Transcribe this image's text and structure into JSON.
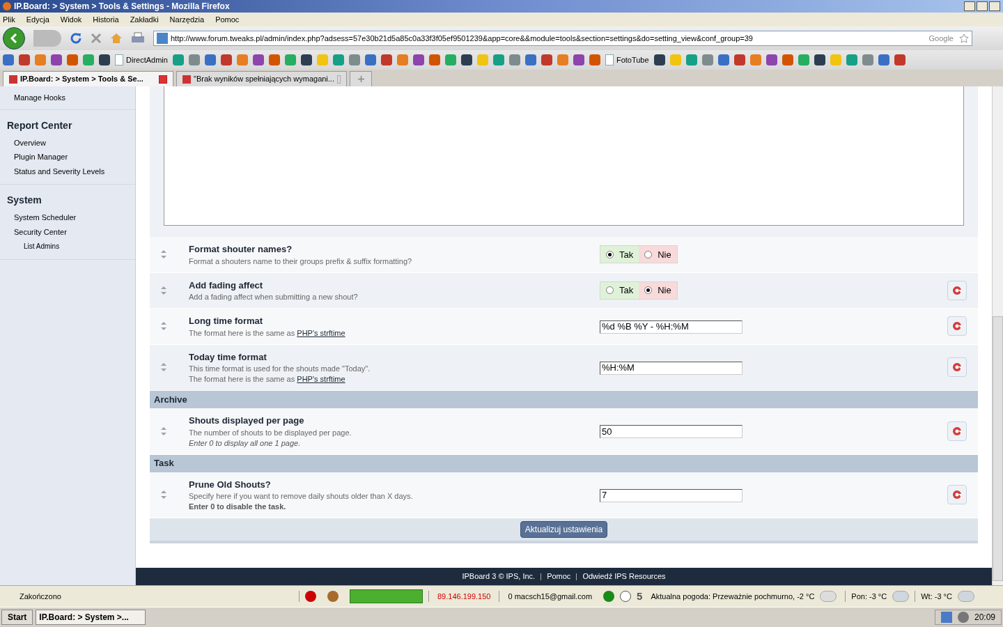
{
  "window": {
    "title": "IP.Board: > System > Tools & Settings - Mozilla Firefox"
  },
  "menu": [
    "Plik",
    "Edycja",
    "Widok",
    "Historia",
    "Zakładki",
    "Narzędzia",
    "Pomoc"
  ],
  "address_bar": {
    "value": "http://www.forum.tweaks.pl/admin/index.php?adsess=57e30b21d5a85c0a33f3f05ef9501239&app=core&&module=tools&section=settings&do=setting_view&conf_group=39"
  },
  "search": {
    "placeholder": "Google"
  },
  "bookmarks": [
    {
      "kind": "icon"
    },
    {
      "kind": "icon"
    },
    {
      "kind": "icon"
    },
    {
      "kind": "icon"
    },
    {
      "kind": "icon"
    },
    {
      "kind": "icon"
    },
    {
      "kind": "icon"
    },
    {
      "kind": "labeled",
      "label": "DirectAdmin"
    },
    {
      "kind": "icon"
    },
    {
      "kind": "icon"
    },
    {
      "kind": "icon"
    },
    {
      "kind": "icon"
    },
    {
      "kind": "icon"
    },
    {
      "kind": "icon"
    },
    {
      "kind": "icon"
    },
    {
      "kind": "icon"
    },
    {
      "kind": "icon"
    },
    {
      "kind": "icon"
    },
    {
      "kind": "icon"
    },
    {
      "kind": "icon"
    },
    {
      "kind": "icon"
    },
    {
      "kind": "icon"
    },
    {
      "kind": "icon"
    },
    {
      "kind": "icon"
    },
    {
      "kind": "icon"
    },
    {
      "kind": "icon"
    },
    {
      "kind": "icon"
    },
    {
      "kind": "icon"
    },
    {
      "kind": "icon"
    },
    {
      "kind": "icon"
    },
    {
      "kind": "icon"
    },
    {
      "kind": "icon"
    },
    {
      "kind": "icon"
    },
    {
      "kind": "icon"
    },
    {
      "kind": "icon"
    },
    {
      "kind": "labeled",
      "label": "FotoTube"
    },
    {
      "kind": "icon"
    },
    {
      "kind": "icon"
    },
    {
      "kind": "icon"
    },
    {
      "kind": "icon"
    },
    {
      "kind": "icon"
    },
    {
      "kind": "icon"
    },
    {
      "kind": "icon"
    },
    {
      "kind": "icon"
    },
    {
      "kind": "icon"
    },
    {
      "kind": "icon"
    },
    {
      "kind": "icon"
    },
    {
      "kind": "icon"
    },
    {
      "kind": "icon"
    },
    {
      "kind": "icon"
    },
    {
      "kind": "icon"
    },
    {
      "kind": "icon"
    }
  ],
  "tabs": [
    {
      "label": "IP.Board: > System > Tools & Se...",
      "selected": true
    },
    {
      "label": "\"Brak wyników spełniających wymagani...",
      "selected": false
    }
  ],
  "sidebar": {
    "top_items": [
      {
        "label": "Manage Hooks"
      }
    ],
    "sections": [
      {
        "title": "Report Center",
        "items": [
          {
            "label": "Overview"
          },
          {
            "label": "Plugin Manager"
          },
          {
            "label": "Status and Severity Levels"
          }
        ]
      },
      {
        "title": "System",
        "items": [
          {
            "label": "System Scheduler"
          },
          {
            "label": "Security Center",
            "children": [
              {
                "label": "List Admins"
              }
            ]
          }
        ]
      }
    ]
  },
  "settings": [
    {
      "rows": [
        {
          "kind": "yesno",
          "title": "Format shouter names?",
          "description": [
            {
              "kind": "plain",
              "text": "Format a shouters name to their groups prefix & suffix formatting?"
            }
          ],
          "options": [
            {
              "label": "Tak",
              "selected": true
            },
            {
              "label": "Nie",
              "selected": false
            }
          ],
          "revert": false
        },
        {
          "kind": "yesno",
          "title": "Add fading affect",
          "description": [
            {
              "kind": "plain",
              "text": "Add a fading affect when submitting a new shout?"
            }
          ],
          "options": [
            {
              "label": "Tak",
              "selected": false
            },
            {
              "label": "Nie",
              "selected": true
            }
          ],
          "revert": true
        },
        {
          "kind": "text",
          "title": "Long time format",
          "description": [
            {
              "kind": "plain",
              "text": "The format here is the same as",
              "link": "PHP's strftime"
            }
          ],
          "value": "%d %B %Y - %H:%M",
          "revert": true
        },
        {
          "kind": "text",
          "title": "Today time format",
          "description": [
            {
              "kind": "plain",
              "text": "This time format is used for the shouts made \"Today\"."
            },
            {
              "kind": "plain",
              "text": "The format here is the same as",
              "link": "PHP's strftime"
            }
          ],
          "value": "%H:%M",
          "revert": true
        }
      ]
    },
    {
      "header": "Archive",
      "rows": [
        {
          "kind": "text",
          "title": "Shouts displayed per page",
          "description": [
            {
              "kind": "plain",
              "text": "The number of shouts to be displayed per page."
            },
            {
              "kind": "italic",
              "text": "Enter 0 to display all one 1 page."
            }
          ],
          "value": "50",
          "revert": true
        }
      ]
    },
    {
      "header": "Task",
      "rows": [
        {
          "kind": "text",
          "title": "Prune Old Shouts?",
          "description": [
            {
              "kind": "plain",
              "text": "Specify here if you want to remove daily shouts older than X days."
            },
            {
              "kind": "bold",
              "text": "Enter 0 to disable the task."
            }
          ],
          "value": "7",
          "revert": true
        }
      ]
    }
  ],
  "submit": {
    "label": "Aktualizuj ustawienia"
  },
  "footer": {
    "links": [
      "IPBoard 3 © IPS, Inc.",
      "Pomoc",
      "Odwiedź IPS Resources"
    ]
  },
  "status_bar": {
    "status": "Zakończono",
    "ip": "89.146.199.150",
    "mail": "0 macsch15@gmail.com",
    "counter": "5",
    "weather": "Aktualna pogoda: Przeważnie pochmurno, -2 °C",
    "forecast": [
      "Pon: -3 °C",
      "Wt: -3 °C"
    ]
  },
  "taskbar": {
    "start": "Start",
    "task": "IP.Board: > System >...",
    "clock": "20:09"
  }
}
